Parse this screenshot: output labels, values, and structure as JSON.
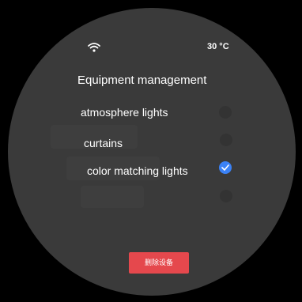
{
  "status_bar": {
    "wifi_icon": "wifi-icon",
    "temperature": "30 °C"
  },
  "page": {
    "title": "Equipment management"
  },
  "devices": [
    {
      "label": "atmosphere lights",
      "selected": false
    },
    {
      "label": "curtains",
      "selected": false
    },
    {
      "label": "color matching lights",
      "selected": true
    },
    {
      "label": "",
      "selected": false
    }
  ],
  "actions": {
    "delete_label": "删除设备"
  },
  "colors": {
    "background": "#3a3a3a",
    "accent": "#3b82f6",
    "danger": "#e5484d"
  }
}
